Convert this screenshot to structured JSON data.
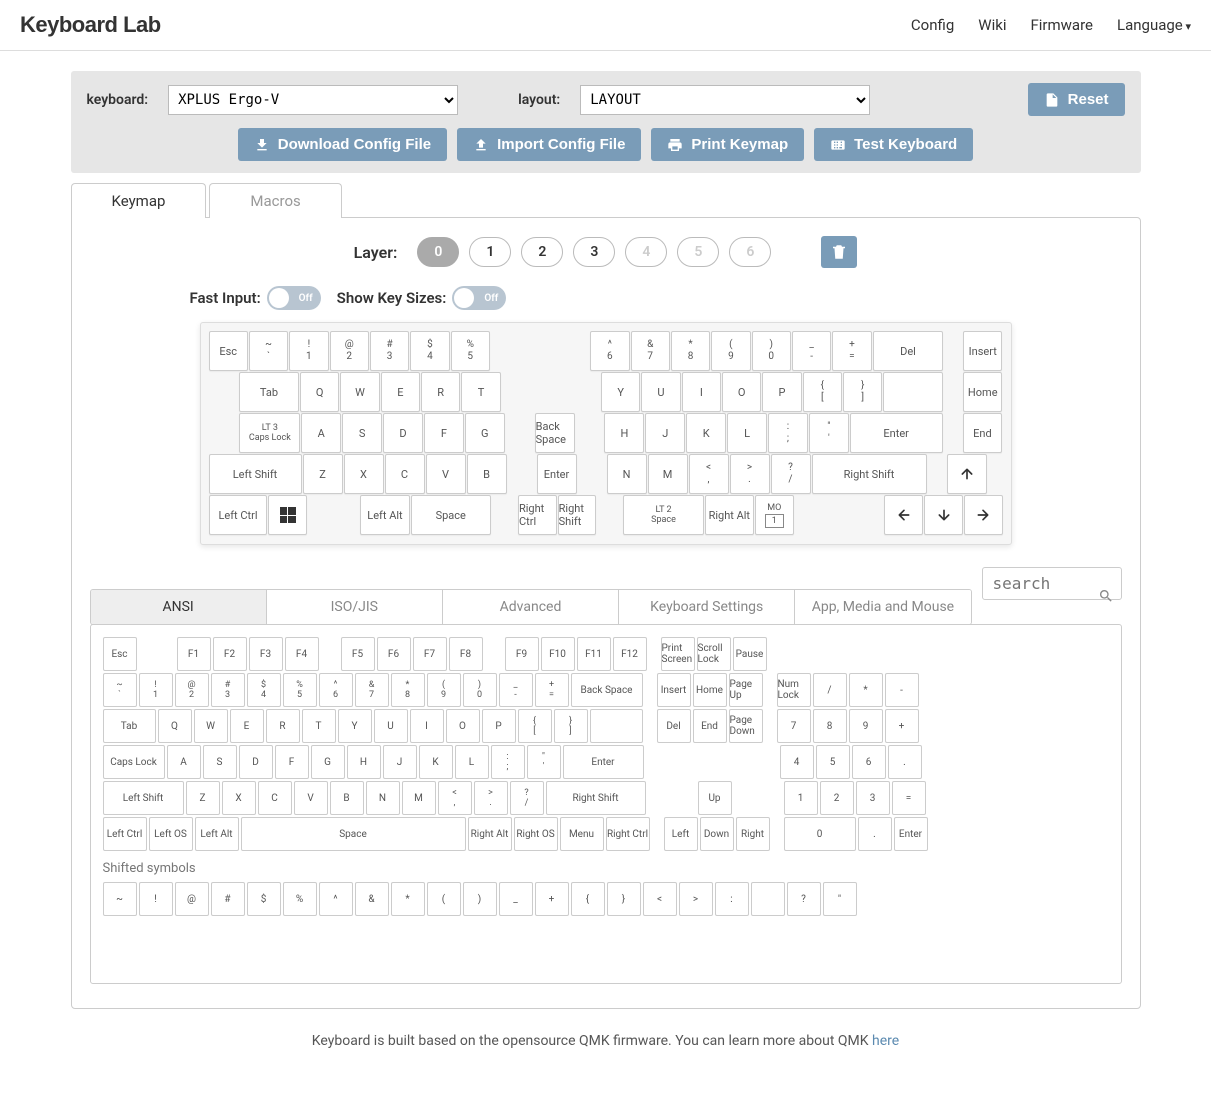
{
  "brand": "Keyboard Lab",
  "nav": {
    "config": "Config",
    "wiki": "Wiki",
    "firmware": "Firmware",
    "language": "Language"
  },
  "selectors": {
    "keyboard_label": "keyboard:",
    "keyboard_value": "XPLUS Ergo-V",
    "layout_label": "layout:",
    "layout_value": "LAYOUT"
  },
  "buttons": {
    "reset": "Reset",
    "download": "Download Config File",
    "import": "Import Config File",
    "print": "Print Keymap",
    "test": "Test Keyboard"
  },
  "main_tabs": {
    "keymap": "Keymap",
    "macros": "Macros"
  },
  "layer": {
    "label": "Layer:",
    "options": [
      "0",
      "1",
      "2",
      "3",
      "4",
      "5",
      "6"
    ],
    "active": "0"
  },
  "toggles": {
    "fast_input_label": "Fast Input:",
    "show_sizes_label": "Show Key Sizes:",
    "off": "Off"
  },
  "keymap": {
    "r0": [
      "Esc",
      "~|`",
      "!|1",
      "@|2",
      "#|3",
      "$|4",
      "%|5",
      "^|6",
      "&|7",
      "*|8",
      "(|9",
      ")|0",
      "_|-",
      "+|=",
      "Del",
      "Insert"
    ],
    "r1": [
      "Tab",
      "Q",
      "W",
      "E",
      "R",
      "T",
      "Y",
      "U",
      "I",
      "O",
      "P",
      "{|[",
      "}|]",
      "||\\",
      "Home"
    ],
    "r2": [
      "LT 3|Caps Lock",
      "A",
      "S",
      "D",
      "F",
      "G",
      "Back Space",
      "H",
      "J",
      "K",
      "L",
      ":|;",
      "\"|'",
      "Enter",
      "End"
    ],
    "r3": [
      "Left Shift",
      "Z",
      "X",
      "C",
      "V",
      "B",
      "Enter",
      "N",
      "M",
      "<|,",
      ">|.",
      "?|/",
      "Right Shift",
      "↑"
    ],
    "r4": [
      "Left Ctrl",
      "win",
      "Left Alt",
      "Space",
      "Right Ctrl",
      "Right Shift",
      "LT 2|Space",
      "Right Alt",
      "MO|1",
      "←",
      "↓",
      "→"
    ]
  },
  "subtabs": {
    "ansi": "ANSI",
    "iso": "ISO/JIS",
    "advanced": "Advanced",
    "kbset": "Keyboard Settings",
    "app": "App, Media and Mouse"
  },
  "search_placeholder": "search",
  "palette": {
    "r0": [
      "Esc",
      "",
      "F1",
      "F2",
      "F3",
      "F4",
      "",
      "F5",
      "F6",
      "F7",
      "F8",
      "",
      "F9",
      "F10",
      "F11",
      "F12",
      "",
      "Print Screen",
      "Scroll Lock",
      "Pause"
    ],
    "r1": [
      "~|`",
      "!|1",
      "@|2",
      "#|3",
      "$|4",
      "%|5",
      "^|6",
      "&|7",
      "*|8",
      "(|9",
      ")|0",
      "_|-",
      "+|=",
      "Back Space",
      "",
      "Insert",
      "Home",
      "Page Up",
      "",
      "Num Lock",
      "/",
      "*",
      "-"
    ],
    "r2": [
      "Tab",
      "Q",
      "W",
      "E",
      "R",
      "T",
      "Y",
      "U",
      "I",
      "O",
      "P",
      "{|[",
      "}|]",
      "||\\",
      "",
      "Del",
      "End",
      "Page Down",
      "",
      "7",
      "8",
      "9",
      "+"
    ],
    "r3": [
      "Caps Lock",
      "A",
      "S",
      "D",
      "F",
      "G",
      "H",
      "J",
      "K",
      "L",
      ":|;",
      "\"|'",
      "Enter",
      "",
      "",
      "",
      "",
      "",
      "4",
      "5",
      "6",
      "."
    ],
    "r4": [
      "Left Shift",
      "Z",
      "X",
      "C",
      "V",
      "B",
      "N",
      "M",
      "<|,",
      ">|.",
      "?|/",
      "Right Shift",
      "",
      "",
      "Up",
      "",
      "",
      "1",
      "2",
      "3",
      "="
    ],
    "r5": [
      "Left Ctrl",
      "Left OS",
      "Left Alt",
      "Space",
      "Right Alt",
      "Right OS",
      "Menu",
      "Right Ctrl",
      "",
      "Left",
      "Down",
      "Right",
      "",
      "0",
      ".",
      "Enter"
    ],
    "shifted_label": "Shifted symbols",
    "shifted": [
      "~",
      "!",
      "@",
      "#",
      "$",
      "%",
      "^",
      "&",
      "*",
      "(",
      ")",
      "_",
      "+",
      "{",
      "}",
      "<",
      ">",
      ":",
      "|",
      "?",
      "\""
    ]
  },
  "footer": {
    "text_pre": "Keyboard is built based on the opensource QMK firmware. You can learn more about QMK ",
    "link": "here"
  }
}
